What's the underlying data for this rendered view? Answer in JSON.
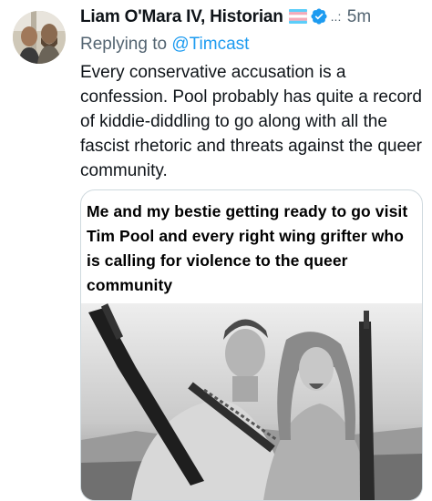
{
  "tweet": {
    "author_name": "Liam O'Mara IV, Historian",
    "flag_icon": "transgender-flag-icon",
    "verified_icon": "verified-badge-icon",
    "more_dots": "..:",
    "time": "5m",
    "replying_prefix": "Replying to",
    "replying_handle": "@Timcast",
    "text": "Every conservative accusation is a confession. Pool probably has quite a record of kiddie-diddling to go along with all the fascist rhetoric and threats against the queer community.",
    "media_caption": "Me and my bestie getting ready to go visit Tim Pool and every right wing grifter who is calling for violence to the queer community"
  },
  "colors": {
    "link": "#1d9bf0",
    "secondary": "#536471",
    "text": "#0f1419"
  }
}
